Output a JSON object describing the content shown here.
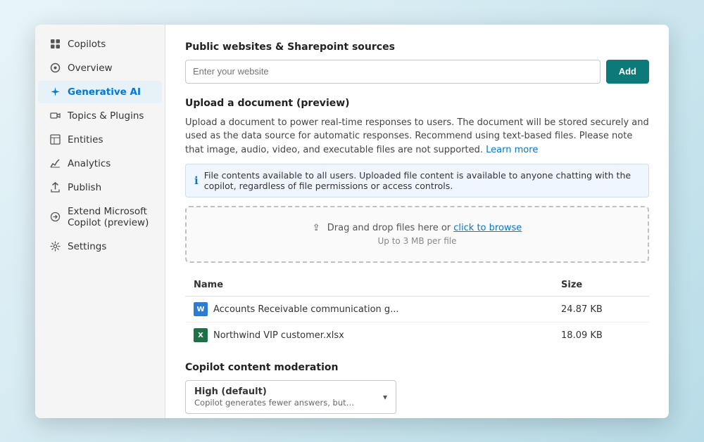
{
  "sidebar": {
    "items": [
      {
        "id": "copilots",
        "label": "Copilots",
        "icon": "grid"
      },
      {
        "id": "overview",
        "label": "Overview",
        "icon": "circle"
      },
      {
        "id": "generative-ai",
        "label": "Generative AI",
        "icon": "sparkle",
        "active": true
      },
      {
        "id": "topics-plugins",
        "label": "Topics & Plugins",
        "icon": "plugin"
      },
      {
        "id": "entities",
        "label": "Entities",
        "icon": "table"
      },
      {
        "id": "analytics",
        "label": "Analytics",
        "icon": "chart"
      },
      {
        "id": "publish",
        "label": "Publish",
        "icon": "upload"
      },
      {
        "id": "extend-copilot",
        "label": "Extend Microsoft Copilot (preview)",
        "icon": "extend"
      },
      {
        "id": "settings",
        "label": "Settings",
        "icon": "gear"
      }
    ]
  },
  "main": {
    "public_websites_title": "Public websites & Sharepoint sources",
    "website_placeholder": "Enter your website",
    "add_button_label": "Add",
    "upload_section_title": "Upload a document (preview)",
    "upload_description": "Upload a document to power real-time responses to users. The document will be stored securely and used as the data source for automatic responses. Recommend using text-based files. Please note that image, audio, video, and executable files are not supported.",
    "learn_more_label": "Learn more",
    "info_banner_text": "File contents available to all users.  Uploaded file content is available to anyone chatting with the copilot, regardless of file permissions or access controls.",
    "dropzone_text": "Drag and drop files here or ",
    "dropzone_link": "click to browse",
    "dropzone_sub": "Up to 3 MB per file",
    "table_col_name": "Name",
    "table_col_size": "Size",
    "files": [
      {
        "icon": "docx",
        "name": "Accounts Receivable communication g...",
        "size": "24.87 KB"
      },
      {
        "icon": "xlsx",
        "name": "Northwind VIP customer.xlsx",
        "size": "18.09 KB"
      }
    ],
    "moderation_title": "Copilot content moderation",
    "moderation_value": "High (default)",
    "moderation_sub": "Copilot generates fewer answers, but responses are more..."
  }
}
